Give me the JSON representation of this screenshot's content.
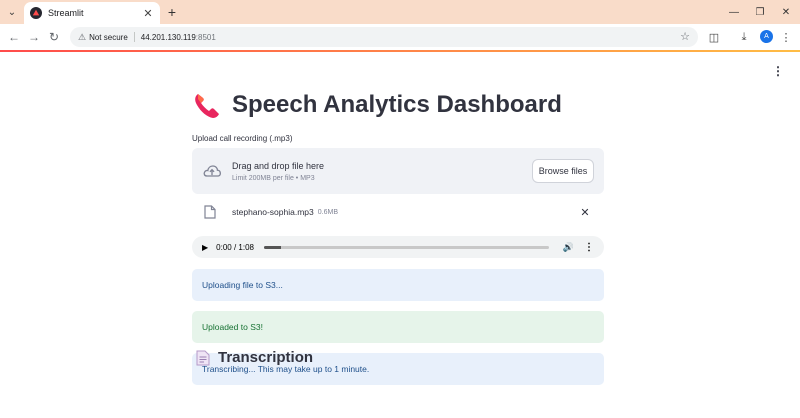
{
  "browser": {
    "tab_title": "Streamlit",
    "url_warning": "Not secure",
    "url_host": "44.201.130.119",
    "url_port": ":8501",
    "avatar_initial": "A"
  },
  "icons": {
    "tab_dropdown": "chevron-down-icon",
    "favicon": "streamlit-icon",
    "new_tab": "plus-icon",
    "back": "arrow-left-icon",
    "forward": "arrow-right-icon",
    "reload": "reload-icon",
    "bookmark": "star-icon",
    "upload": "cloud-upload-icon",
    "file": "file-icon",
    "phone": "telephone-receiver-icon",
    "document": "document-icon"
  },
  "app": {
    "title": "Speech Analytics Dashboard",
    "upload_label": "Upload call recording (.mp3)",
    "dropzone_title": "Drag and drop file here",
    "dropzone_limit": "Limit 200MB per file • MP3",
    "browse_label": "Browse files",
    "file_name": "stephano-sophia.mp3",
    "file_size": "0.6MB",
    "audio_time": "0:00 / 1:08",
    "audio_progress": 0.0,
    "messages": [
      {
        "type": "info",
        "text": "Uploading file to S3..."
      },
      {
        "type": "success",
        "text": "Uploaded to S3!"
      },
      {
        "type": "info",
        "text": "Transcribing... This may take up to 1 minute."
      }
    ],
    "section_title": "Transcription"
  },
  "colors": {
    "tab_bar": "#f9dcc9",
    "info_bg": "#e8f0fb",
    "success_bg": "#e6f4ea",
    "accent": "#ff4b4b"
  }
}
